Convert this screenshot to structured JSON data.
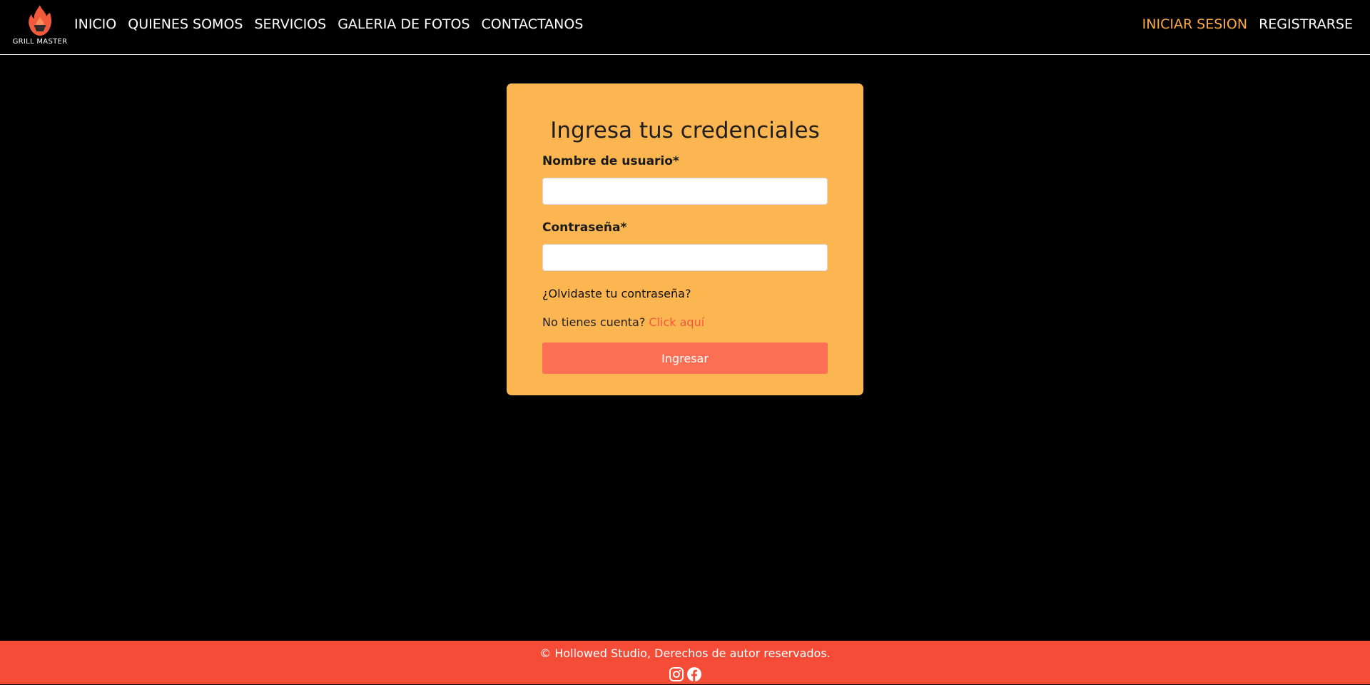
{
  "brand": {
    "name": "GRILL MASTER",
    "logo_icon": "flame-icon",
    "accent_color": "#fbab45"
  },
  "nav": {
    "left_items": [
      {
        "label": "INICIO"
      },
      {
        "label": "QUIENES SOMOS"
      },
      {
        "label": "SERVICIOS"
      },
      {
        "label": "GALERIA DE FOTOS"
      },
      {
        "label": "CONTACTANOS"
      }
    ],
    "right_items": [
      {
        "label": "INICIAR SESION",
        "active": true
      },
      {
        "label": "REGISTRARSE",
        "active": false
      }
    ]
  },
  "login": {
    "title": "Ingresa tus credenciales",
    "username_label": "Nombre de usuario*",
    "username_value": "",
    "password_label": "Contraseña*",
    "password_value": "",
    "forgot_link": "¿Olvidaste tu contraseña?",
    "no_account_text": "No tienes cuenta?",
    "register_link": "Click aquí",
    "submit_label": "Ingresar",
    "card_color": "#fbb551",
    "button_color": "#fb6f54"
  },
  "footer": {
    "copyright": "© Hollowed Studio, Derechos de autor reservados.",
    "social": [
      "instagram-icon",
      "facebook-icon"
    ],
    "color": "#f54c37"
  }
}
